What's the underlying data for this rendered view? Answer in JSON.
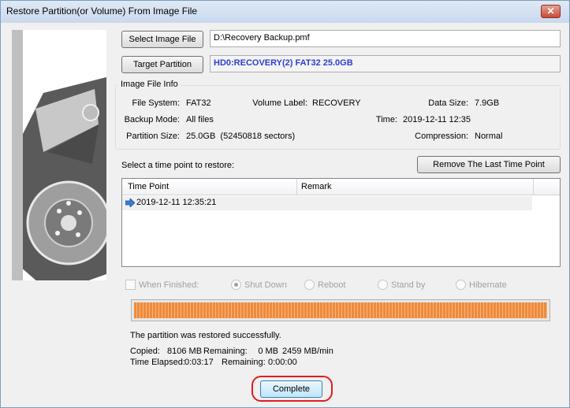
{
  "window": {
    "title": "Restore Partition(or Volume) From Image File",
    "close_label": "✕"
  },
  "select_image": {
    "button_label": "Select Image File",
    "path_value": "D:\\Recovery Backup.pmf"
  },
  "target": {
    "button_label": "Target Partition",
    "value": "HD0:RECOVERY(2) FAT32 25.0GB"
  },
  "image_info": {
    "title": "Image File Info",
    "file_system_label": "File System:",
    "file_system": "FAT32",
    "volume_label_label": "Volume Label:",
    "volume_label": "RECOVERY",
    "data_size_label": "Data Size:",
    "data_size": "7.9GB",
    "backup_mode_label": "Backup Mode:",
    "backup_mode": "All files",
    "time_label": "Time:",
    "time": "2019-12-11 12:35",
    "partition_size_label": "Partition Size:",
    "partition_size": "25.0GB  (52450818 sectors)",
    "compression_label": "Compression:",
    "compression": "Normal"
  },
  "time_points": {
    "prompt": "Select a time point to restore:",
    "remove_button": "Remove The Last Time Point",
    "columns": [
      "Time Point",
      "Remark"
    ],
    "rows": [
      {
        "time_point": "2019-12-11 12:35:21",
        "remark": ""
      }
    ]
  },
  "options": {
    "when_finished": "When Finished:",
    "shut_down": "Shut Down",
    "reboot": "Reboot",
    "stand_by": "Stand by",
    "hibernate": "Hibernate",
    "selected": "Shut Down"
  },
  "progress": {
    "percent": 100
  },
  "status": {
    "message": "The partition was restored successfully.",
    "copied_label": "Copied:",
    "copied": "8106 MB",
    "remaining_label": "Remaining:",
    "remaining": "0 MB",
    "speed": "2459 MB/min",
    "elapsed_label": "Time Elapsed:",
    "elapsed": "0:03:17",
    "time_remaining_label": "Remaining:",
    "time_remaining": "0:00:00"
  },
  "complete_button": "Complete",
  "colors": {
    "target_text": "#2b3fd0",
    "progress": "#ee8a3c",
    "highlight": "#e11d1d"
  }
}
